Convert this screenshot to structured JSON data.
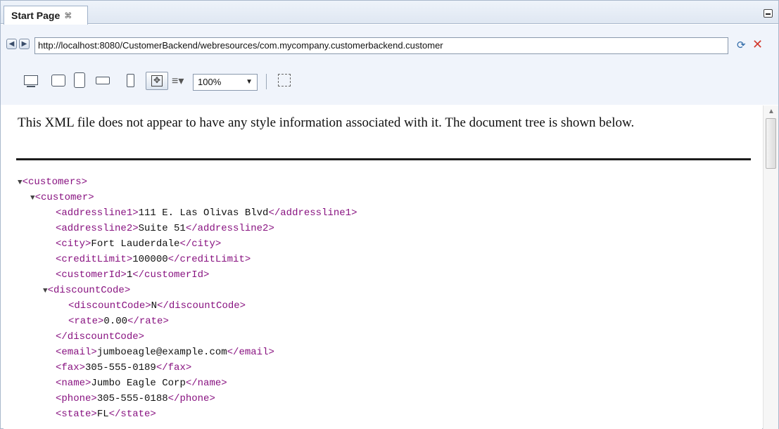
{
  "tab": {
    "label": "Start Page",
    "close": "⌘"
  },
  "toolbar": {
    "back_icon": "back-arrow-icon",
    "forward_icon": "forward-arrow-icon",
    "url": "http://localhost:8080/CustomerBackend/webresources/com.mycompany.customerbackend.customer",
    "zoom": "100%"
  },
  "content": {
    "notice": "This XML file does not appear to have any style information associated with it. The document tree is shown below.",
    "tree": [
      {
        "indent": 0,
        "toggle": "▼",
        "open": "<customers>",
        "text": "",
        "close": ""
      },
      {
        "indent": 1,
        "toggle": "▼",
        "open": "<customer>",
        "text": "",
        "close": ""
      },
      {
        "indent": 3,
        "toggle": "",
        "open": "<addressline1>",
        "text": "111 E. Las Olivas Blvd",
        "close": "</addressline1>"
      },
      {
        "indent": 3,
        "toggle": "",
        "open": "<addressline2>",
        "text": "Suite 51",
        "close": "</addressline2>"
      },
      {
        "indent": 3,
        "toggle": "",
        "open": "<city>",
        "text": "Fort Lauderdale",
        "close": "</city>"
      },
      {
        "indent": 3,
        "toggle": "",
        "open": "<creditLimit>",
        "text": "100000",
        "close": "</creditLimit>"
      },
      {
        "indent": 3,
        "toggle": "",
        "open": "<customerId>",
        "text": "1",
        "close": "</customerId>"
      },
      {
        "indent": 2,
        "toggle": "▼",
        "open": "<discountCode>",
        "text": "",
        "close": ""
      },
      {
        "indent": 4,
        "toggle": "",
        "open": "<discountCode>",
        "text": "N",
        "close": "</discountCode>"
      },
      {
        "indent": 4,
        "toggle": "",
        "open": "<rate>",
        "text": "0.00",
        "close": "</rate>"
      },
      {
        "indent": 3,
        "toggle": "",
        "open": "</discountCode>",
        "text": "",
        "close": ""
      },
      {
        "indent": 3,
        "toggle": "",
        "open": "<email>",
        "text": "jumboeagle@example.com",
        "close": "</email>"
      },
      {
        "indent": 3,
        "toggle": "",
        "open": "<fax>",
        "text": "305-555-0189",
        "close": "</fax>"
      },
      {
        "indent": 3,
        "toggle": "",
        "open": "<name>",
        "text": "Jumbo Eagle Corp",
        "close": "</name>"
      },
      {
        "indent": 3,
        "toggle": "",
        "open": "<phone>",
        "text": "305-555-0188",
        "close": "</phone>"
      },
      {
        "indent": 3,
        "toggle": "",
        "open": "<state>",
        "text": "FL",
        "close": "</state>"
      }
    ]
  },
  "colors": {
    "tag": "#881280",
    "text": "#111111",
    "accent": "#2f6aa8",
    "stop": "#d23a2e"
  }
}
